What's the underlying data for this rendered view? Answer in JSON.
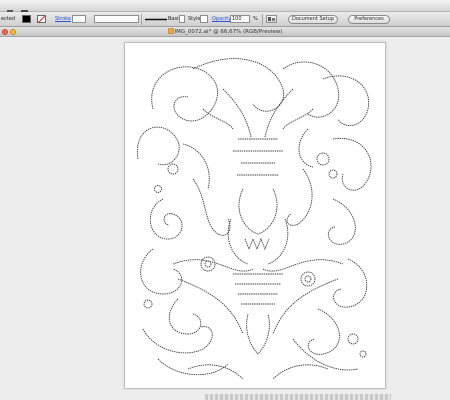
{
  "options_bar": {
    "mode_label": "ected",
    "stroke_label": "Stroke",
    "brush_label": "Basic",
    "style_label": "Style",
    "opacity_label": "Opacity",
    "opacity_value": "100",
    "opacity_unit": "%",
    "document_setup_label": "Document Setup",
    "preferences_label": "Preferences",
    "fill_color": "#000000"
  },
  "window": {
    "title": "IMG_0072.ai* @ 66,67% (RGB/Preview)"
  },
  "icons": {
    "app_menu": "selection-tool-icon",
    "workspace": "workspace-menu-icon"
  },
  "colors": {
    "accent_link": "#2b4fd6",
    "close_light": "#ff5f57",
    "min_light": "#febc2e",
    "zoom_light": "#28c840"
  }
}
